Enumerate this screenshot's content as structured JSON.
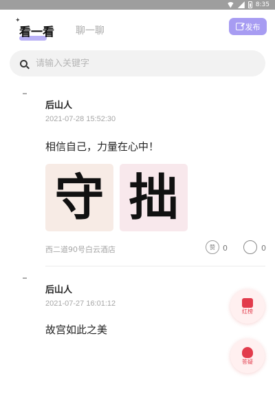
{
  "status_bar": {
    "time": "8:35"
  },
  "header": {
    "tab_active": "看一看",
    "tab_inactive": "聊一聊",
    "publish_label": "发布"
  },
  "search": {
    "placeholder": "请输入关键字"
  },
  "posts": [
    {
      "author": "后山人",
      "time": "2021-07-28 15:52:30",
      "content": "相信自己，力量在心中！",
      "images": [
        "守",
        "拙"
      ],
      "location": "西二道90号白云酒店",
      "like_label": "赞",
      "likes": "0",
      "comments": "0"
    },
    {
      "author": "后山人",
      "time": "2021-07-27 16:01:12",
      "content": "故宫如此之美"
    }
  ],
  "floating": {
    "red_label": "红榜",
    "ask_label": "答疑",
    "accent_color": "#e23c4c"
  },
  "colors": {
    "primary": "#a79cf2",
    "status_bar": "#9e9e9e"
  }
}
